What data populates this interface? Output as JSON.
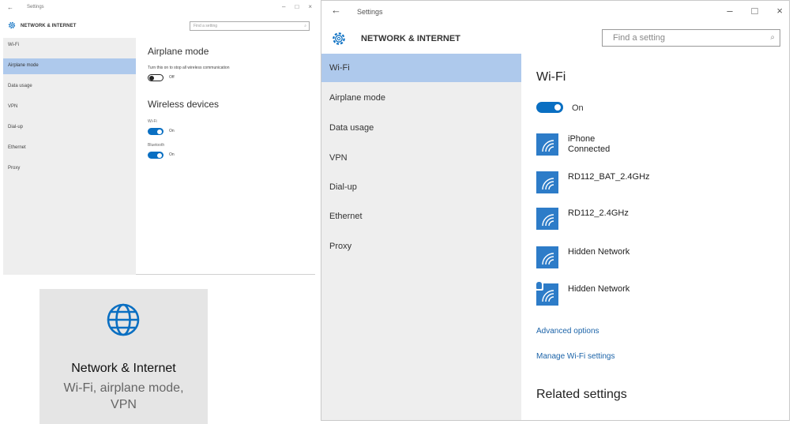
{
  "small_window": {
    "back_glyph": "←",
    "title": "Settings",
    "controls": [
      "–",
      "□",
      "×"
    ],
    "section_title": "NETWORK & INTERNET",
    "search_placeholder": "Find a setting",
    "nav": [
      {
        "label": "Wi-Fi",
        "selected": false
      },
      {
        "label": "Airplane mode",
        "selected": true
      },
      {
        "label": "Data usage",
        "selected": false
      },
      {
        "label": "VPN",
        "selected": false
      },
      {
        "label": "Dial-up",
        "selected": false
      },
      {
        "label": "Ethernet",
        "selected": false
      },
      {
        "label": "Proxy",
        "selected": false
      }
    ],
    "airplane": {
      "heading": "Airplane mode",
      "description": "Turn this on to stop all wireless communication",
      "toggle_state": "Off"
    },
    "wireless": {
      "heading": "Wireless devices",
      "wifi_label": "Wi-Fi",
      "wifi_state": "On",
      "bluetooth_label": "Bluetooth",
      "bluetooth_state": "On"
    }
  },
  "tile": {
    "icon": "globe-icon",
    "title": "Network & Internet",
    "subtitle_line1": "Wi-Fi, airplane mode,",
    "subtitle_line2": "VPN"
  },
  "big_window": {
    "back_glyph": "←",
    "title": "Settings",
    "controls": [
      "–",
      "□",
      "×"
    ],
    "section_title": "NETWORK & INTERNET",
    "search_placeholder": "Find a setting",
    "nav": [
      {
        "label": "Wi-Fi",
        "selected": true
      },
      {
        "label": "Airplane mode",
        "selected": false
      },
      {
        "label": "Data usage",
        "selected": false
      },
      {
        "label": "VPN",
        "selected": false
      },
      {
        "label": "Dial-up",
        "selected": false
      },
      {
        "label": "Ethernet",
        "selected": false
      },
      {
        "label": "Proxy",
        "selected": false
      }
    ],
    "heading": "Wi-Fi",
    "wifi_state": "On",
    "networks": [
      {
        "name": "iPhone",
        "status": "Connected",
        "secured": false
      },
      {
        "name": "RD112_BAT_2.4GHz",
        "status": "",
        "secured": false
      },
      {
        "name": "RD112_2.4GHz",
        "status": "",
        "secured": false
      },
      {
        "name": "Hidden Network",
        "status": "",
        "secured": false
      },
      {
        "name": "Hidden Network",
        "status": "",
        "secured": true
      }
    ],
    "links": {
      "advanced": "Advanced options",
      "manage": "Manage Wi-Fi settings"
    },
    "related_heading": "Related settings"
  },
  "colors": {
    "accent": "#0a6fc2",
    "nav_selected": "#aec9ec",
    "nav_bg": "#eeeeee",
    "tile_bg": "#e5e5e5",
    "wifi_tile": "#2d7cc8",
    "link": "#1b63a8"
  }
}
